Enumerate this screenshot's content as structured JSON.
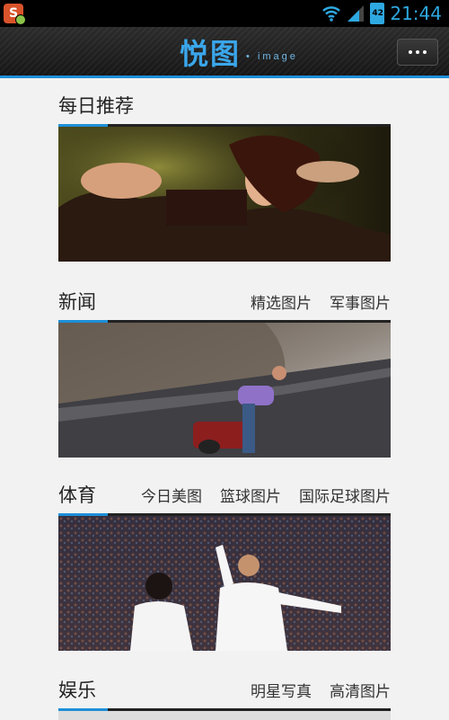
{
  "status_bar": {
    "time": "21:44",
    "battery_level": "42",
    "notification_icon": "s-app-icon"
  },
  "app_bar": {
    "title": "悦图",
    "subtitle": "image",
    "overflow_icon": "more-icon"
  },
  "sections": [
    {
      "title": "每日推荐",
      "subcategories": []
    },
    {
      "title": "新闻",
      "subcategories": [
        "精选图片",
        "军事图片"
      ]
    },
    {
      "title": "体育",
      "subcategories": [
        "今日美图",
        "篮球图片",
        "国际足球图片"
      ]
    },
    {
      "title": "娱乐",
      "subcategories": [
        "明星写真",
        "高清图片"
      ]
    }
  ],
  "colors": {
    "accent": "#1e8fd8",
    "background": "#f2f2f2",
    "actionbar": "#1c1c1c"
  }
}
